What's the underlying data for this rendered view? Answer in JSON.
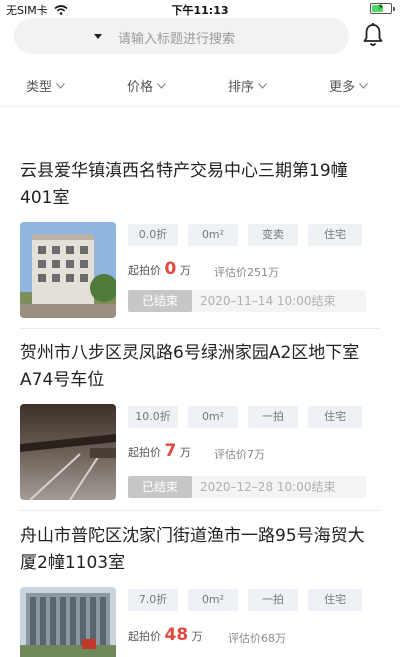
{
  "status_bar": {
    "carrier": "无SIM卡",
    "time": "下午11:13",
    "battery_level": 0.6
  },
  "search": {
    "placeholder": "请输入标题进行搜索"
  },
  "filters": [
    {
      "label": "类型"
    },
    {
      "label": "价格"
    },
    {
      "label": "排序"
    },
    {
      "label": "更多"
    }
  ],
  "listings": [
    {
      "title": "云县爱华镇滇西名特产交易中心三期第19幢401室",
      "tags": [
        "0.0折",
        "0m²",
        "变卖",
        "住宅"
      ],
      "start_price_label": "起拍价",
      "start_price": "0",
      "start_price_unit": "万",
      "estimate": "评估价251万",
      "status": "已结束",
      "end_time": "2020–11–14 10:00结束"
    },
    {
      "title": "贺州市八步区灵凤路6号绿洲家园A2区地下室A74号车位",
      "tags": [
        "10.0折",
        "0m²",
        "一拍",
        "住宅"
      ],
      "start_price_label": "起拍价",
      "start_price": "7",
      "start_price_unit": "万",
      "estimate": "评估价7万",
      "status": "已结束",
      "end_time": "2020–12–28 10:00结束"
    },
    {
      "title": "舟山市普陀区沈家门街道渔市一路95号海贸大厦2幢1103室",
      "tags": [
        "7.0折",
        "0m²",
        "一拍",
        "住宅"
      ],
      "start_price_label": "起拍价",
      "start_price": "48",
      "start_price_unit": "万",
      "estimate": "评估价68万"
    }
  ]
}
